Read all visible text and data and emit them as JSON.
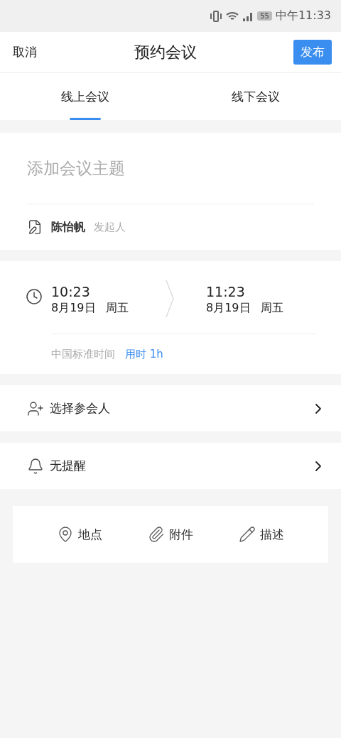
{
  "status_bar": {
    "battery": "55",
    "time": "中午11:33"
  },
  "header": {
    "cancel": "取消",
    "title": "预约会议",
    "publish": "发布"
  },
  "tabs": [
    {
      "label": "线上会议",
      "selected": true
    },
    {
      "label": "线下会议",
      "selected": false
    }
  ],
  "subject": {
    "placeholder": "添加会议主题"
  },
  "organizer": {
    "name": "陈怡帆",
    "role": "发起人"
  },
  "time": {
    "start": {
      "time": "10:23",
      "date": "8月19日",
      "weekday": "周五"
    },
    "end": {
      "time": "11:23",
      "date": "8月19日",
      "weekday": "周五"
    },
    "timezone": "中国标准时间",
    "duration": "用时 1h"
  },
  "rows": [
    {
      "label": "选择参会人",
      "kind": "attendees"
    },
    {
      "label": "无提醒",
      "kind": "reminder"
    }
  ],
  "actions": [
    {
      "label": "地点",
      "kind": "location"
    },
    {
      "label": "附件",
      "kind": "attachment"
    },
    {
      "label": "描述",
      "kind": "description"
    }
  ]
}
